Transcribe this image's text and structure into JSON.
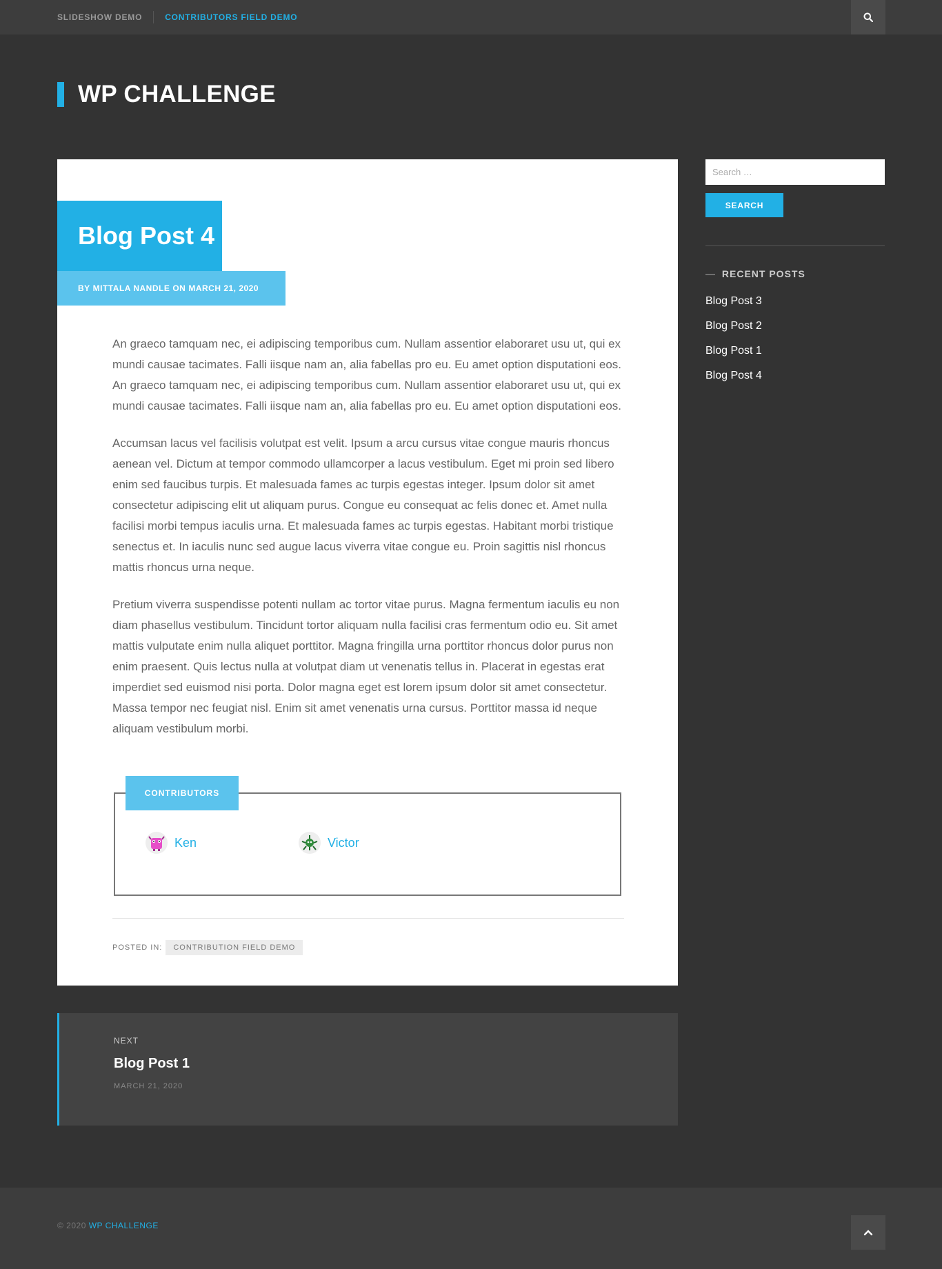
{
  "nav": {
    "items": [
      {
        "label": "SLIDESHOW DEMO"
      },
      {
        "label": "CONTRIBUTORS FIELD DEMO"
      }
    ],
    "search_icon": "search-icon"
  },
  "site": {
    "title": "WP CHALLENGE"
  },
  "post": {
    "title": "Blog Post 4",
    "meta": {
      "by": "BY",
      "author": "MITTALA NANDLE",
      "on": "ON",
      "date": "MARCH 21, 2020"
    },
    "paragraphs": [
      "An graeco tamquam nec, ei adipiscing temporibus cum. Nullam assentior elaboraret usu ut, qui ex mundi causae tacimates. Falli iisque nam an, alia fabellas pro eu. Eu amet option disputationi eos. An graeco tamquam nec, ei adipiscing temporibus cum. Nullam assentior elaboraret usu ut, qui ex mundi causae tacimates. Falli iisque nam an, alia fabellas pro eu. Eu amet option disputationi eos.",
      "Accumsan lacus vel facilisis volutpat est velit. Ipsum a arcu cursus vitae congue mauris rhoncus aenean vel. Dictum at tempor commodo ullamcorper a lacus vestibulum. Eget mi proin sed libero enim sed faucibus turpis. Et malesuada fames ac turpis egestas integer. Ipsum dolor sit amet consectetur adipiscing elit ut aliquam purus. Congue eu consequat ac felis donec et. Amet nulla facilisi morbi tempus iaculis urna. Et malesuada fames ac turpis egestas. Habitant morbi tristique senectus et. In iaculis nunc sed augue lacus viverra vitae congue eu. Proin sagittis nisl rhoncus mattis rhoncus urna neque.",
      "Pretium viverra suspendisse potenti nullam ac tortor vitae purus. Magna fermentum iaculis eu non diam phasellus vestibulum. Tincidunt tortor aliquam nulla facilisi cras fermentum odio eu. Sit amet mattis vulputate enim nulla aliquet porttitor. Magna fringilla urna porttitor rhoncus dolor purus non enim praesent. Quis lectus nulla at volutpat diam ut venenatis tellus in. Placerat in egestas erat imperdiet sed euismod nisi porta. Dolor magna eget est lorem ipsum dolor sit amet consectetur. Massa tempor nec feugiat nisl. Enim sit amet venenatis urna cursus. Porttitor massa id neque aliquam vestibulum morbi."
    ],
    "contributors": {
      "label": "CONTRIBUTORS",
      "people": [
        {
          "name": "Ken",
          "avatar_icon": "pink-monster-avatar-icon"
        },
        {
          "name": "Victor",
          "avatar_icon": "green-monster-avatar-icon"
        }
      ]
    },
    "posted_in": {
      "label": "POSTED IN:",
      "category": "CONTRIBUTION FIELD DEMO"
    }
  },
  "post_nav": {
    "kicker": "NEXT",
    "title": "Blog Post 1",
    "date": "MARCH 21, 2020"
  },
  "sidebar": {
    "search_placeholder": "Search …",
    "search_button": "SEARCH",
    "recent_title_dash": "—",
    "recent_title": "RECENT POSTS",
    "recent_posts": [
      "Blog Post 3",
      "Blog Post 2",
      "Blog Post 1",
      "Blog Post 4"
    ]
  },
  "footer": {
    "copyright": "© 2020",
    "site_link": "WP CHALLENGE",
    "to_top_icon": "chevron-up-icon"
  },
  "colors": {
    "accent": "#22b0e5",
    "accent_light": "#5bc3ed",
    "background": "#333333",
    "nav_bg": "#3d3d3d"
  }
}
